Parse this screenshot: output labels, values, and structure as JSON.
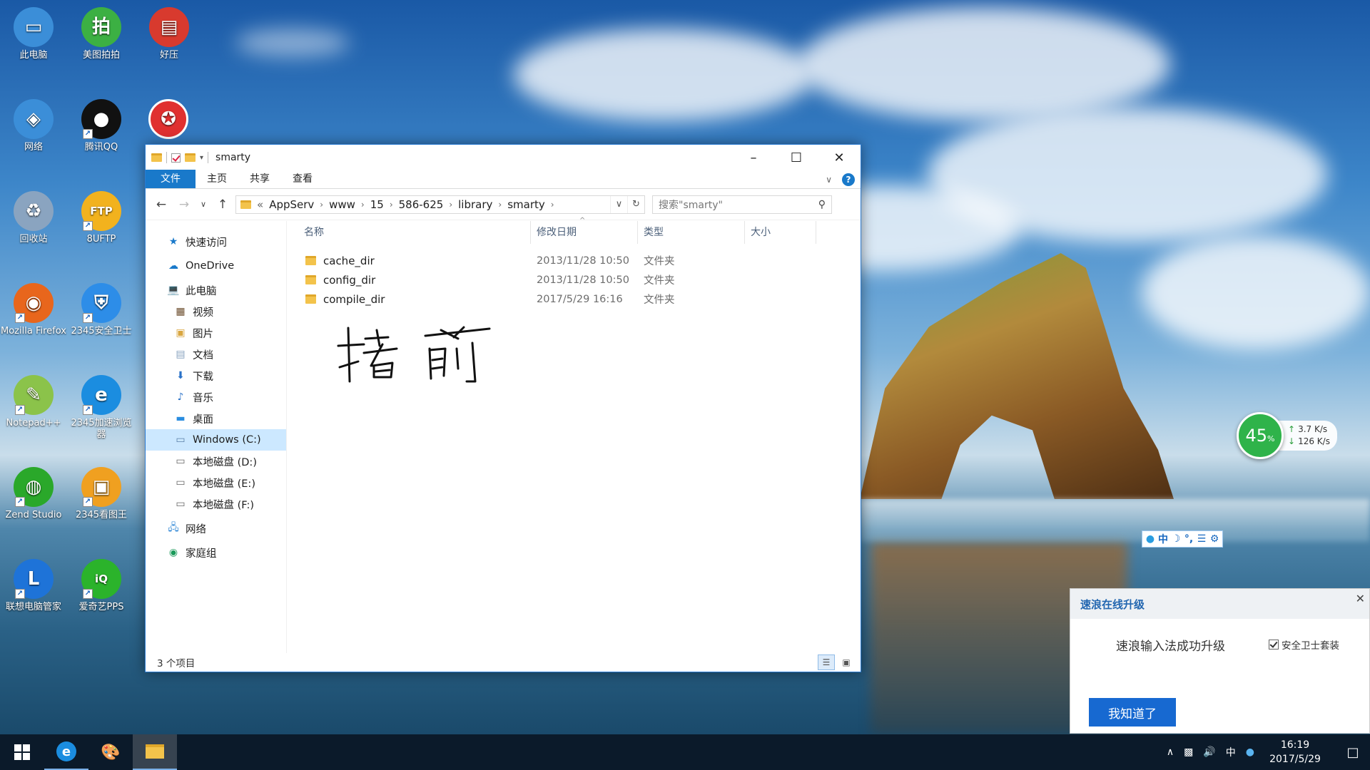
{
  "desktop": {
    "icons": [
      {
        "label": "此电脑",
        "icon": "computer-icon",
        "color": "#3b8ed8"
      },
      {
        "label": "美图拍拍",
        "icon": "camera-app-icon",
        "color": "#3cb043"
      },
      {
        "label": "好压",
        "icon": "archive-icon",
        "color": "#d83a2e"
      },
      {
        "label": "网络",
        "icon": "network-icon",
        "color": "#3b8ed8"
      },
      {
        "label": "腾讯QQ",
        "icon": "qq-penguin-icon",
        "color": "#111111"
      },
      {
        "label": "回收站",
        "icon": "recycle-bin-icon",
        "color": "#8aa4c0"
      },
      {
        "label": "8UFTP",
        "icon": "ftp-icon",
        "color": "#f2b21e"
      },
      {
        "label": "Mozilla Firefox",
        "icon": "firefox-icon",
        "color": "#e8661c"
      },
      {
        "label": "2345安全卫士",
        "icon": "shield-icon",
        "color": "#2d8de8"
      },
      {
        "label": "Notepad++",
        "icon": "notepad-icon",
        "color": "#8bc34a"
      },
      {
        "label": "2345加速浏览器",
        "icon": "browser-icon",
        "color": "#1b8de0"
      },
      {
        "label": "Zend Studio",
        "icon": "zend-icon",
        "color": "#2aa82a"
      },
      {
        "label": "2345看图王",
        "icon": "image-viewer-icon",
        "color": "#f0a020"
      },
      {
        "label": "联想电脑管家",
        "icon": "lenovo-icon",
        "color": "#1e73d8"
      },
      {
        "label": "爱奇艺PPS",
        "icon": "iqiyi-icon",
        "color": "#2bb32b"
      }
    ],
    "extra_icon": {
      "icon": "award-icon",
      "color": "#e03030"
    }
  },
  "explorer": {
    "title": "smarty",
    "tabs": [
      "文件",
      "主页",
      "共享",
      "查看"
    ],
    "breadcrumb": [
      "AppServ",
      "www",
      "15",
      "586-625",
      "library",
      "smarty"
    ],
    "breadcrumb_prefix": "«",
    "search_placeholder": "搜索\"smarty\"",
    "nav": {
      "quick_access": "快速访问",
      "onedrive": "OneDrive",
      "this_pc": "此电脑",
      "pc_items": [
        {
          "label": "视频",
          "icon": "video-folder-icon"
        },
        {
          "label": "图片",
          "icon": "pictures-folder-icon"
        },
        {
          "label": "文档",
          "icon": "documents-folder-icon"
        },
        {
          "label": "下载",
          "icon": "downloads-folder-icon"
        },
        {
          "label": "音乐",
          "icon": "music-folder-icon"
        },
        {
          "label": "桌面",
          "icon": "desktop-folder-icon"
        },
        {
          "label": "Windows (C:)",
          "icon": "drive-c-icon"
        },
        {
          "label": "本地磁盘 (D:)",
          "icon": "drive-icon"
        },
        {
          "label": "本地磁盘 (E:)",
          "icon": "drive-icon"
        },
        {
          "label": "本地磁盘 (F:)",
          "icon": "drive-icon"
        }
      ],
      "network": "网络",
      "homegroup": "家庭组"
    },
    "columns": {
      "name": "名称",
      "date": "修改日期",
      "type": "类型",
      "size": "大小"
    },
    "files": [
      {
        "name": "cache_dir",
        "date": "2013/11/28 10:50",
        "type": "文件夹"
      },
      {
        "name": "config_dir",
        "date": "2013/11/28 10:50",
        "type": "文件夹"
      },
      {
        "name": "compile_dir",
        "date": "2017/5/29 16:16",
        "type": "文件夹"
      }
    ],
    "status": "3 个项目"
  },
  "net_widget": {
    "percent": "45",
    "percent_sign": "%",
    "up": "3.7 K/s",
    "down": "126 K/s"
  },
  "ime": {
    "items": [
      "中",
      "☽",
      "°,",
      "⚙"
    ]
  },
  "popup": {
    "title": "速浪在线升级",
    "message": "速浪输入法成功升级",
    "option": "安全卫士套装",
    "button": "我知道了"
  },
  "taskbar": {
    "tray_ime": "中",
    "time": "16:19",
    "date": "2017/5/29"
  }
}
